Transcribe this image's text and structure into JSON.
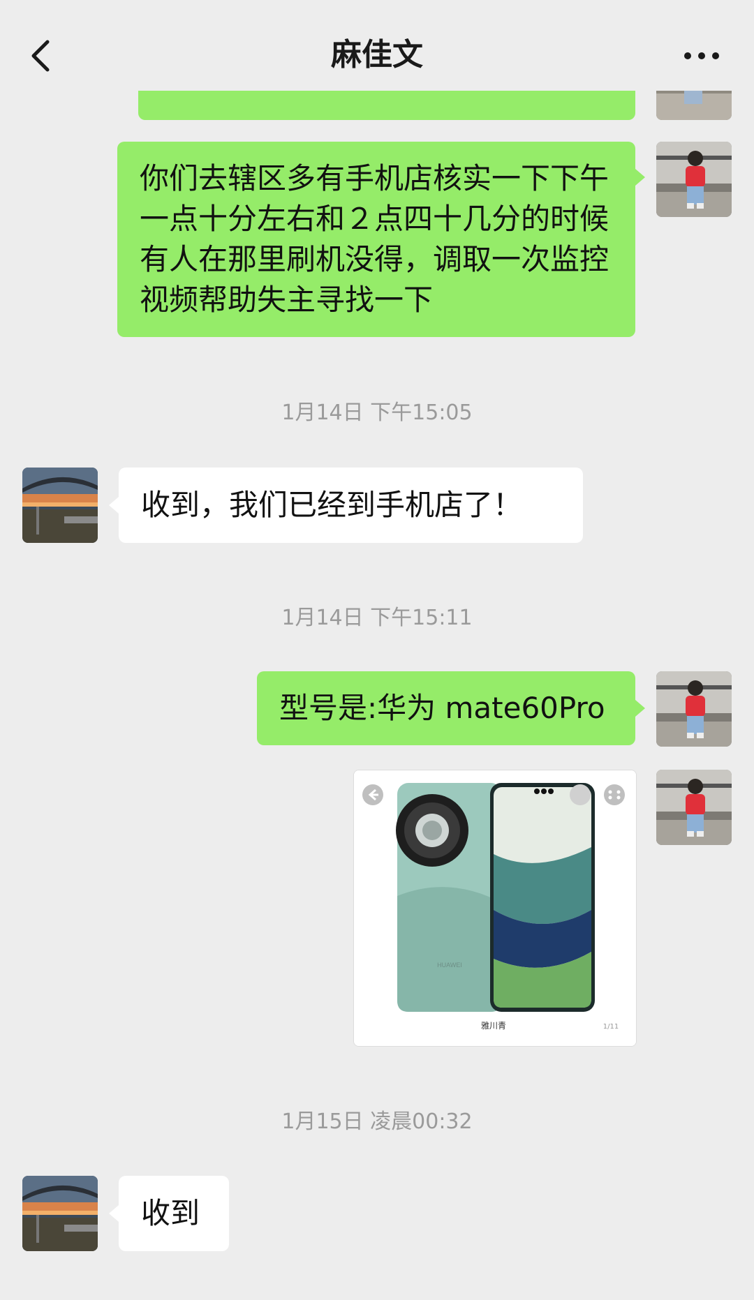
{
  "header": {
    "title": "麻佳文"
  },
  "messages": [
    {
      "from": "me",
      "text": "你们去辖区多有手机店核实一下下午一点十分左右和２点四十几分的时候有人在那里刷机没得，调取一次监控视频帮助失主寻找一下"
    },
    {
      "timestamp": "1月14日 下午15:05"
    },
    {
      "from": "other",
      "text": "收到，我们已经到手机店了！"
    },
    {
      "timestamp": "1月14日 下午15:11"
    },
    {
      "from": "me",
      "text": "型号是:华为 mate60Pro"
    },
    {
      "from": "me",
      "image": {
        "brand": "HUAWEI",
        "caption": "雅川青",
        "page": "1/11"
      }
    },
    {
      "timestamp": "1月15日 凌晨00:32"
    },
    {
      "from": "other",
      "text": "收到"
    }
  ],
  "colors": {
    "bubble_me": "#95ec69",
    "bubble_other": "#ffffff",
    "background": "#ededed"
  },
  "icons": [
    "back-arrow-icon",
    "more-dots-icon"
  ]
}
